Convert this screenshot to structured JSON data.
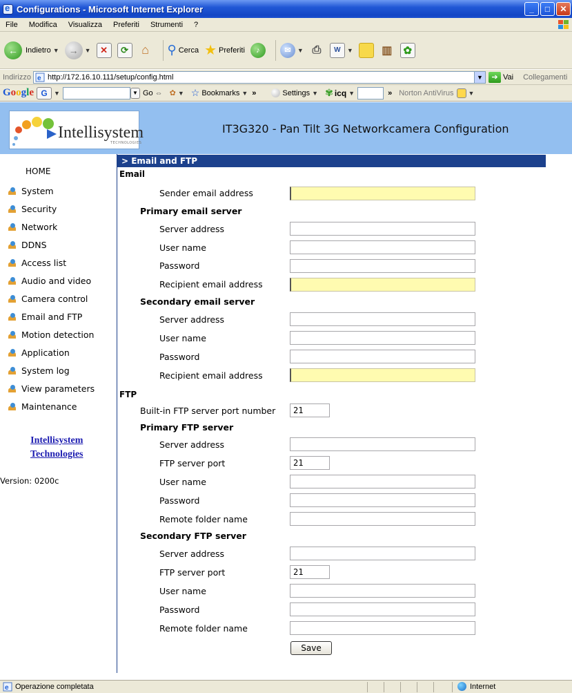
{
  "window": {
    "title": "Configurations - Microsoft Internet Explorer"
  },
  "menubar": {
    "items": [
      "File",
      "Modifica",
      "Visualizza",
      "Preferiti",
      "Strumenti",
      "?"
    ]
  },
  "toolbar": {
    "back_label": "Indietro",
    "search_label": "Cerca",
    "favorites_label": "Preferiti"
  },
  "addressbar": {
    "label": "Indirizzo",
    "url": "http://172.16.10.111/setup/config.html",
    "go_label": "Vai",
    "links_label": "Collegamenti"
  },
  "googlebar": {
    "go_label": "Go",
    "bookmarks_label": "Bookmarks",
    "settings_label": "Settings",
    "icq_label": "icq",
    "norton_label": "Norton AntiVirus"
  },
  "header": {
    "logo_text": "Intellisystem",
    "logo_sub": "TECHNOLOGIES",
    "page_title": "IT3G320 - Pan Tilt 3G Networkcamera Configuration"
  },
  "nav": {
    "home": "HOME",
    "items": [
      "System",
      "Security",
      "Network",
      "DDNS",
      "Access list",
      "Audio and video",
      "Camera control",
      "Email and FTP",
      "Motion detection",
      "Application",
      "System log",
      "View parameters",
      "Maintenance"
    ],
    "company_line1": "Intellisystem",
    "company_line2": "Technologies",
    "version": "Version: 0200c"
  },
  "section": {
    "title": "> Email and FTP"
  },
  "email": {
    "heading": "Email",
    "sender_label": "Sender email address",
    "sender_value": "",
    "primary": {
      "heading": "Primary email server",
      "server_label": "Server address",
      "server_value": "",
      "user_label": "User name",
      "user_value": "",
      "password_label": "Password",
      "password_value": "",
      "recipient_label": "Recipient email address",
      "recipient_value": ""
    },
    "secondary": {
      "heading": "Secondary email server",
      "server_label": "Server address",
      "server_value": "",
      "user_label": "User name",
      "user_value": "",
      "password_label": "Password",
      "password_value": "",
      "recipient_label": "Recipient email address",
      "recipient_value": ""
    }
  },
  "ftp": {
    "heading": "FTP",
    "builtin_port_label": "Built-in FTP server port number",
    "builtin_port_value": "21",
    "primary": {
      "heading": "Primary FTP server",
      "server_label": "Server address",
      "server_value": "",
      "port_label": "FTP server port",
      "port_value": "21",
      "user_label": "User name",
      "user_value": "",
      "password_label": "Password",
      "password_value": "",
      "folder_label": "Remote folder name",
      "folder_value": ""
    },
    "secondary": {
      "heading": "Secondary FTP server",
      "server_label": "Server address",
      "server_value": "",
      "port_label": "FTP server port",
      "port_value": "21",
      "user_label": "User name",
      "user_value": "",
      "password_label": "Password",
      "password_value": "",
      "folder_label": "Remote folder name",
      "folder_value": ""
    }
  },
  "save_label": "Save",
  "statusbar": {
    "text": "Operazione completata",
    "zone": "Internet"
  }
}
